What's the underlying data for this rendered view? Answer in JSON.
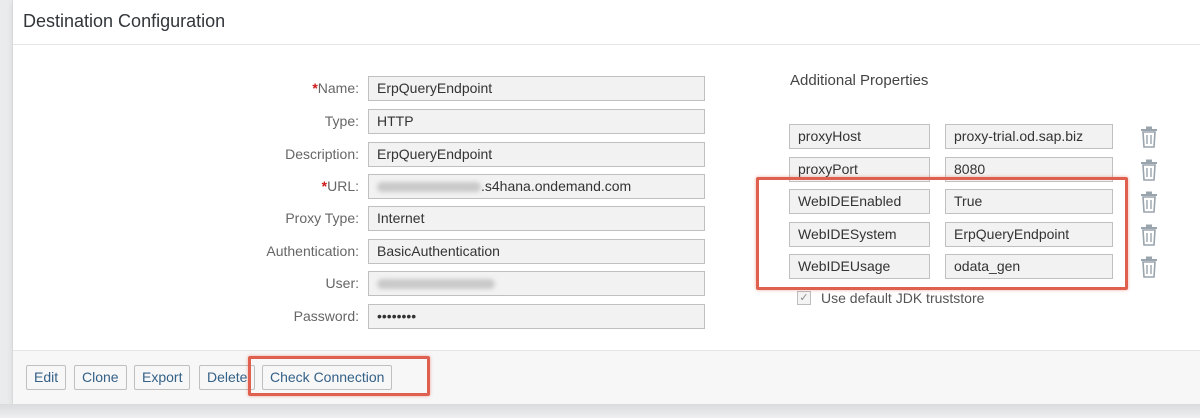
{
  "panel": {
    "title": "Destination Configuration"
  },
  "fields": [
    {
      "label": "Name:",
      "required": true,
      "value": "ErpQueryEndpoint"
    },
    {
      "label": "Type:",
      "required": false,
      "value": "HTTP"
    },
    {
      "label": "Description:",
      "required": false,
      "value": "ErpQueryEndpoint"
    },
    {
      "label": "URL:",
      "required": true,
      "value": ".s4hana.ondemand.com"
    },
    {
      "label": "Proxy Type:",
      "required": false,
      "value": "Internet"
    },
    {
      "label": "Authentication:",
      "required": false,
      "value": "BasicAuthentication"
    },
    {
      "label": "User:",
      "required": false,
      "value": ""
    },
    {
      "label": "Password:",
      "required": false,
      "value": "••••••••"
    }
  ],
  "required_marker": "*",
  "additional": {
    "title": "Additional Properties",
    "properties": [
      {
        "key": "proxyHost",
        "value": "proxy-trial.od.sap.biz"
      },
      {
        "key": "proxyPort",
        "value": "8080"
      },
      {
        "key": "WebIDEEnabled",
        "value": "True"
      },
      {
        "key": "WebIDESystem",
        "value": "ErpQueryEndpoint"
      },
      {
        "key": "WebIDEUsage",
        "value": "odata_gen"
      }
    ],
    "checkbox_label": "Use default JDK truststore",
    "checkbox_checked": true
  },
  "footer": {
    "buttons": [
      "Edit",
      "Clone",
      "Export",
      "Delete",
      "Check Connection"
    ]
  },
  "colors": {
    "highlight": "#e0604f",
    "required": "#cc1919",
    "button_text": "#346187"
  },
  "icons": {
    "delete_property": "trash-icon",
    "checkbox_check": "checkmark-icon"
  }
}
